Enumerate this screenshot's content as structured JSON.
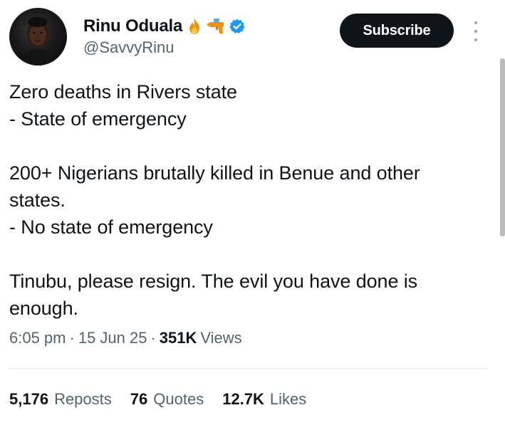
{
  "author": {
    "name": "Rinu Oduala",
    "handle": "@SavvyRinu",
    "badges": [
      "fire-emoji",
      "water-pistol-emoji",
      "verified-badge"
    ],
    "verified_color": "#1d9bf0"
  },
  "actions": {
    "subscribe_label": "Subscribe",
    "more_icon": "more-vertical-icon"
  },
  "tweet": {
    "lines": [
      "Zero deaths in Rivers state",
      "- State of emergency",
      "",
      "200+ Nigerians brutally killed in Benue and other",
      "states.",
      "- No state of emergency",
      "",
      "Tinubu, please resign. The evil you have done is",
      "enough."
    ]
  },
  "meta": {
    "time": "6:05 pm",
    "separator": "·",
    "date": "15 Jun 25",
    "views_count": "351K",
    "views_label": "Views"
  },
  "stats": {
    "reposts_count": "5,176",
    "reposts_label": "Reposts",
    "quotes_count": "76",
    "quotes_label": "Quotes",
    "likes_count": "12.7K",
    "likes_label": "Likes"
  },
  "colors": {
    "text_primary": "#0f1419",
    "text_secondary": "#536471",
    "button_bg": "#0f1419",
    "button_text": "#ffffff"
  }
}
